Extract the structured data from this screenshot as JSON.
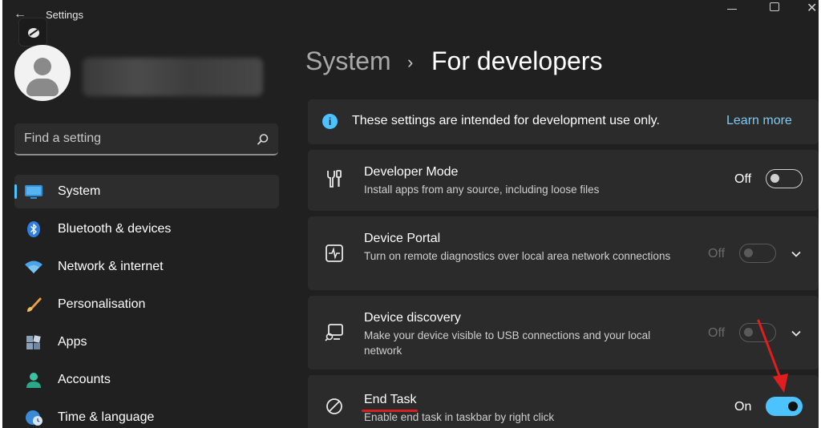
{
  "window": {
    "title": "Settings"
  },
  "search": {
    "placeholder": "Find a setting"
  },
  "sidebar": {
    "items": [
      {
        "label": "System",
        "icon": "monitor-icon",
        "active": true
      },
      {
        "label": "Bluetooth & devices",
        "icon": "bluetooth-icon"
      },
      {
        "label": "Network & internet",
        "icon": "wifi-icon"
      },
      {
        "label": "Personalisation",
        "icon": "brush-icon"
      },
      {
        "label": "Apps",
        "icon": "apps-icon"
      },
      {
        "label": "Accounts",
        "icon": "person-icon"
      },
      {
        "label": "Time & language",
        "icon": "globe-clock-icon"
      }
    ]
  },
  "breadcrumb": {
    "parent": "System",
    "separator": "›",
    "current": "For developers"
  },
  "info": {
    "text": "These settings are intended for development use only.",
    "link": "Learn more"
  },
  "settings": [
    {
      "title": "Developer Mode",
      "desc": "Install apps from any source, including loose files",
      "state": "Off",
      "icon": "tools-icon",
      "toggle": "off",
      "enabled": true,
      "expandable": false
    },
    {
      "title": "Device Portal",
      "desc": "Turn on remote diagnostics over local area network connections",
      "state": "Off",
      "icon": "pulse-monitor-icon",
      "toggle": "off",
      "enabled": false,
      "expandable": true
    },
    {
      "title": "Device discovery",
      "desc": "Make your device visible to USB connections and your local network",
      "state": "Off",
      "icon": "device-search-icon",
      "toggle": "off",
      "enabled": false,
      "expandable": true
    },
    {
      "title": "End Task",
      "desc": "Enable end task in taskbar by right click",
      "state": "On",
      "icon": "block-icon",
      "toggle": "on",
      "enabled": true,
      "expandable": false
    }
  ],
  "colors": {
    "accent": "#4cc2ff",
    "background": "#202020",
    "card": "#2b2b2b",
    "annotation": "#d6201f"
  }
}
